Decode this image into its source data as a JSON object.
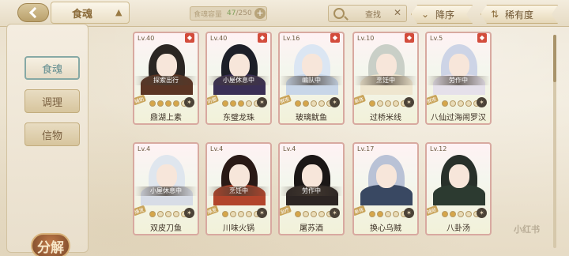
{
  "header": {
    "title": "食魂",
    "capacity_label": "食魂容量",
    "capacity_count": "47",
    "capacity_max": "/250",
    "search_placeholder": "查找",
    "sort_order_label": "降序",
    "sort_key_label": "稀有度"
  },
  "sidebar": {
    "items": [
      {
        "label": "食魂",
        "active": true
      },
      {
        "label": "调理",
        "active": false
      },
      {
        "label": "信物",
        "active": false
      }
    ],
    "decompose_label": "分解"
  },
  "cards": [
    {
      "level": "Lv.40",
      "status": "探索出行",
      "name": "鼎湖上素",
      "type": "辅助",
      "hair": "#2b2623",
      "body": "#5b3524",
      "filled": 4
    },
    {
      "level": "Lv.40",
      "status": "小屋休息中",
      "name": "东璧龙珠",
      "type": "防御",
      "hair": "#1d1f28",
      "body": "#3a2f55",
      "filled": 3
    },
    {
      "level": "Lv.16",
      "status": "编队中",
      "name": "玻璃鱿鱼",
      "type": "群攻",
      "hair": "#dbe6f3",
      "body": "#c8d6e8",
      "filled": 2
    },
    {
      "level": "Lv.10",
      "status": "烹饪中",
      "name": "过桥米线",
      "type": "单体",
      "hair": "#c9cfc7",
      "body": "#efe6cf",
      "filled": 1
    },
    {
      "level": "Lv.5",
      "status": "劳作中",
      "name": "八仙过海闹罗汉",
      "type": "群攻",
      "hair": "#cdd4e6",
      "body": "#e5e0ea",
      "filled": 1
    },
    {
      "level": "Lv.4",
      "status": "小屋休息中",
      "name": "双皮刀鱼",
      "type": "爆发",
      "hair": "#dfe6ee",
      "body": "#d7dce6",
      "filled": 1
    },
    {
      "level": "Lv.4",
      "status": "烹饪中",
      "name": "川味火锅",
      "type": "爆发",
      "hair": "#2a1a16",
      "body": "#b2452c",
      "filled": 1
    },
    {
      "level": "Lv.4",
      "status": "劳作中",
      "name": "屠苏酒",
      "type": "治疗",
      "hair": "#1b1716",
      "body": "#2c2523",
      "filled": 1
    },
    {
      "level": "Lv.17",
      "status": "",
      "name": "换心乌贼",
      "type": "单体",
      "hair": "#b9c2d6",
      "body": "#394862",
      "filled": 2
    },
    {
      "level": "Lv.12",
      "status": "",
      "name": "八卦汤",
      "type": "辅助",
      "hair": "#28302a",
      "body": "#2c3a30",
      "filled": 2
    }
  ],
  "watermark": "小红书"
}
